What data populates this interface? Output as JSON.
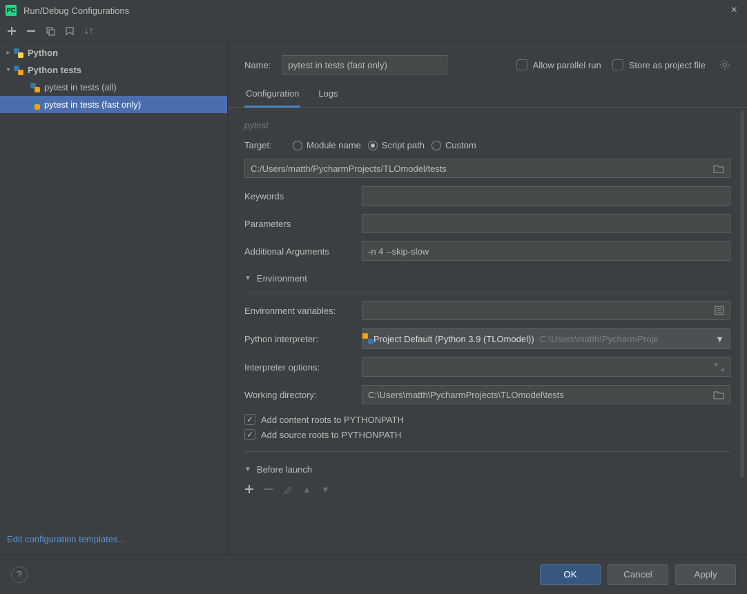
{
  "window": {
    "title": "Run/Debug Configurations"
  },
  "tree": {
    "python_label": "Python",
    "python_tests_label": "Python tests",
    "items": [
      {
        "label": "pytest in tests (all)"
      },
      {
        "label": "pytest in tests (fast only)"
      }
    ],
    "selected_index": 1
  },
  "header": {
    "name_label": "Name:",
    "name_value": "pytest in tests (fast only)",
    "allow_parallel_label": "Allow parallel run",
    "store_as_file_label": "Store as project file"
  },
  "tabs": {
    "configuration": "Configuration",
    "logs": "Logs"
  },
  "form": {
    "section_pytest": "pytest",
    "target_label": "Target:",
    "target_options": {
      "module": "Module name",
      "script": "Script path",
      "custom": "Custom"
    },
    "target_value": "C:/Users/matth/PycharmProjects/TLOmodel/tests",
    "keywords_label": "Keywords",
    "keywords_value": "",
    "parameters_label": "Parameters",
    "parameters_value": "",
    "addl_args_label": "Additional Arguments",
    "addl_args_value": "-n 4 --skip-slow",
    "env_section": "Environment",
    "env_vars_label": "Environment variables:",
    "env_vars_value": "",
    "interp_label": "Python interpreter:",
    "interp_main": "Project Default (Python 3.9 (TLOmodel))",
    "interp_sub": "C:\\Users\\matth\\PycharmProje",
    "interp_opts_label": "Interpreter options:",
    "interp_opts_value": "",
    "workdir_label": "Working directory:",
    "workdir_value": "C:\\Users\\matth\\PycharmProjects\\TLOmodel\\tests",
    "add_content_roots": "Add content roots to PYTHONPATH",
    "add_source_roots": "Add source roots to PYTHONPATH",
    "before_launch": "Before launch"
  },
  "footer": {
    "edit_templates": "Edit configuration templates...",
    "ok": "OK",
    "cancel": "Cancel",
    "apply": "Apply"
  }
}
